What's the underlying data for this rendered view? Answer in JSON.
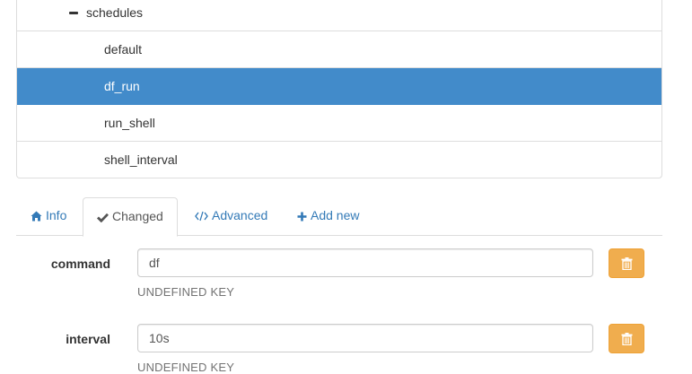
{
  "tree": {
    "parent": {
      "label": "schedules",
      "icon": "minus-icon"
    },
    "items": [
      {
        "label": "default",
        "selected": false
      },
      {
        "label": "df_run",
        "selected": true
      },
      {
        "label": "run_shell",
        "selected": false
      },
      {
        "label": "shell_interval",
        "selected": false
      }
    ]
  },
  "tabs": [
    {
      "label": "Info",
      "icon": "home-icon",
      "active": false
    },
    {
      "label": "Changed",
      "icon": "check-icon",
      "active": true
    },
    {
      "label": "Advanced",
      "icon": "code-icon",
      "active": false
    },
    {
      "label": "Add new",
      "icon": "plus-icon",
      "active": false
    }
  ],
  "fields": [
    {
      "label": "command",
      "value": "df",
      "help": "UNDEFINED KEY",
      "delete_icon": "trash-icon"
    },
    {
      "label": "interval",
      "value": "10s",
      "help": "UNDEFINED KEY",
      "delete_icon": "trash-icon"
    }
  ],
  "colors": {
    "selected_row": "#428bca",
    "link": "#337ab7",
    "warning_button": "#f0ad4e"
  }
}
